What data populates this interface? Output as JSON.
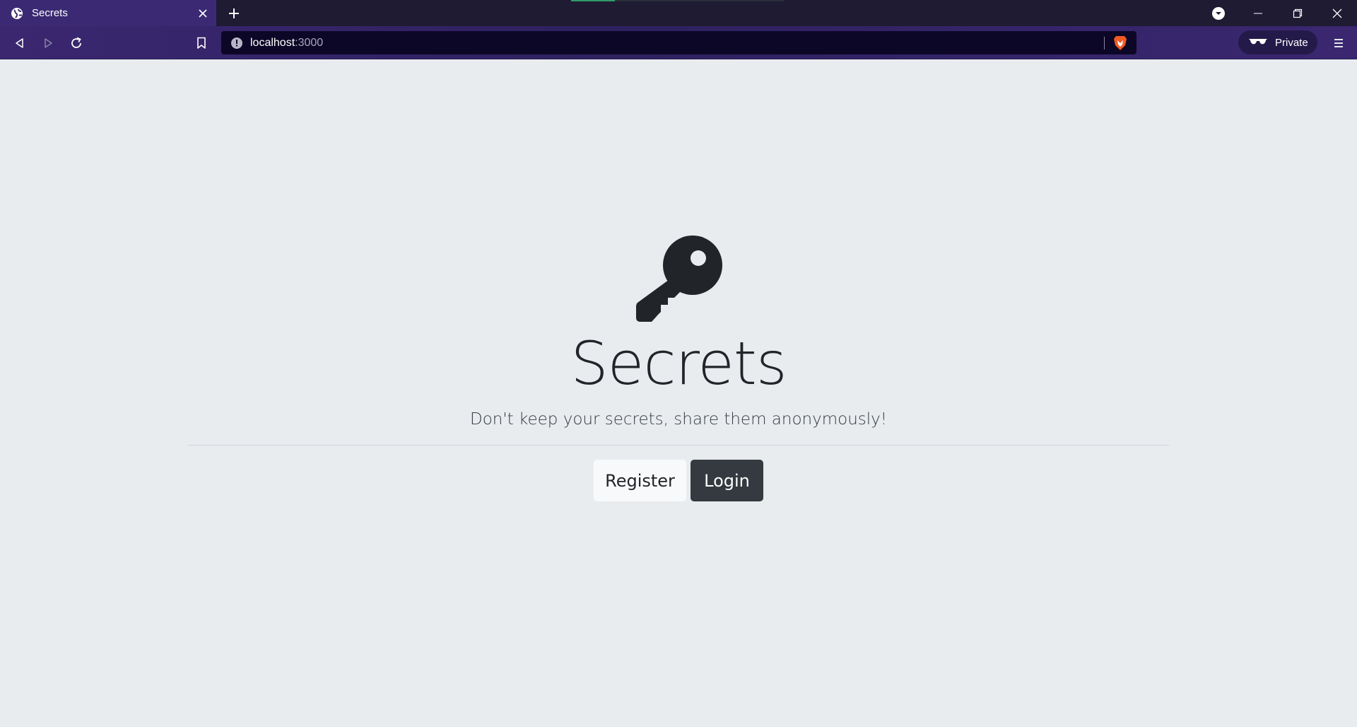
{
  "browser": {
    "tab": {
      "title": "Secrets",
      "favicon": "globe-icon",
      "close_icon": "close-icon"
    },
    "new_tab_icon": "plus-icon",
    "window_controls": [
      "profile-dropdown-icon",
      "minimize-icon",
      "restore-icon",
      "close-icon"
    ],
    "toolbar": {
      "back_icon": "back-icon",
      "forward_icon": "forward-icon",
      "reload_icon": "reload-icon",
      "bookmark_icon": "bookmark-icon",
      "url_host": "localhost",
      "url_port": ":3000",
      "site_info_icon": "info-icon",
      "shields_icon": "brave-shields-icon",
      "private_label": "Private",
      "private_icon": "glasses-icon",
      "menu_icon": "hamburger-menu-icon"
    }
  },
  "page": {
    "hero_icon": "key-icon",
    "title": "Secrets",
    "lead": "Don't keep your secrets, share them anonymously!",
    "buttons": {
      "register": "Register",
      "login": "Login"
    }
  },
  "colors": {
    "page_background": "#e9ecef",
    "text_dark": "#212529",
    "button_dark": "#343a40",
    "button_light": "#f8f9fa",
    "tab_active": "#3b2a73",
    "urlbar": "#0c0726"
  }
}
